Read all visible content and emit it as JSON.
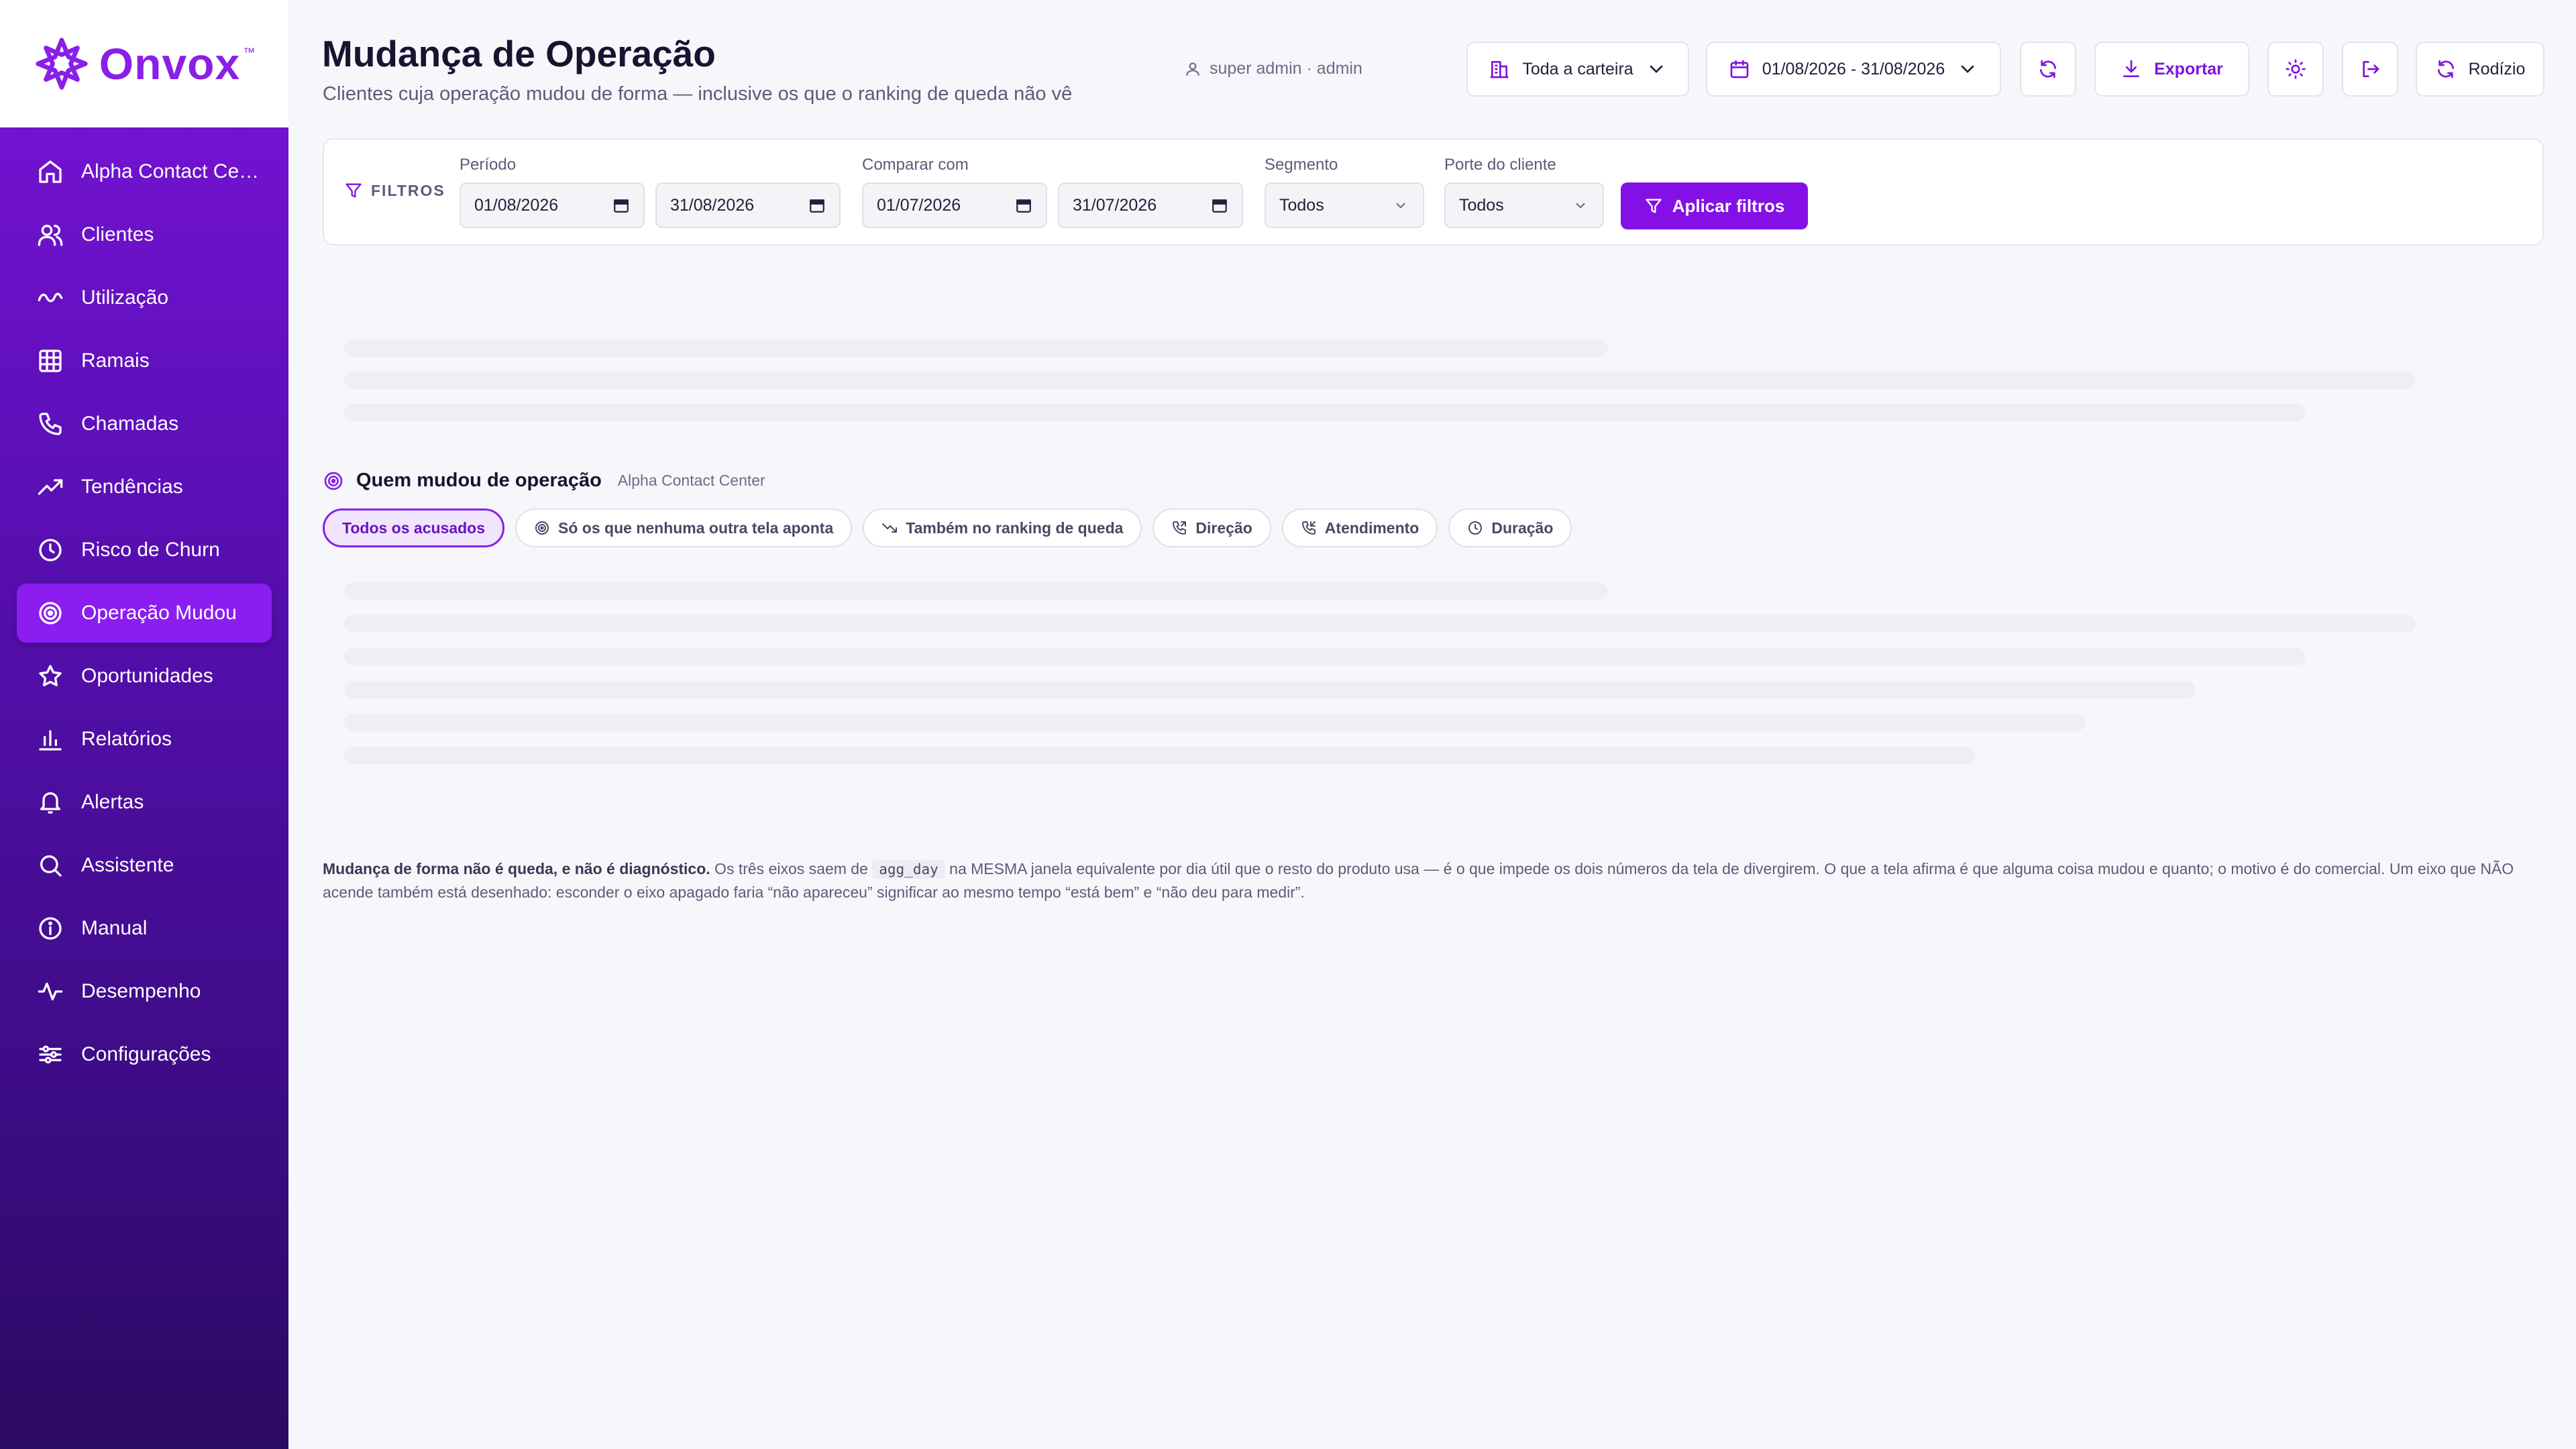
{
  "brand": {
    "name": "Onvox",
    "tm": "™",
    "accent": "#8a1fe8"
  },
  "sidebar": {
    "items": [
      {
        "label": "Alpha Contact Center",
        "icon": "home-icon"
      },
      {
        "label": "Clientes",
        "icon": "users-icon"
      },
      {
        "label": "Utilização",
        "icon": "wave-icon"
      },
      {
        "label": "Ramais",
        "icon": "grid-icon"
      },
      {
        "label": "Chamadas",
        "icon": "phone-icon"
      },
      {
        "label": "Tendências",
        "icon": "trending-up-icon"
      },
      {
        "label": "Risco de Churn",
        "icon": "clock-icon"
      },
      {
        "label": "Operação Mudou",
        "icon": "target-icon",
        "active": true
      },
      {
        "label": "Oportunidades",
        "icon": "star-icon"
      },
      {
        "label": "Relatórios",
        "icon": "bar-chart-icon"
      },
      {
        "label": "Alertas",
        "icon": "bell-icon"
      },
      {
        "label": "Assistente",
        "icon": "search-icon"
      },
      {
        "label": "Manual",
        "icon": "info-icon"
      },
      {
        "label": "Desempenho",
        "icon": "activity-icon"
      },
      {
        "label": "Configurações",
        "icon": "sliders-icon"
      }
    ]
  },
  "header": {
    "title": "Mudança de Operação",
    "subtitle": "Clientes cuja operação mudou de forma — inclusive os que o ranking de queda não vê",
    "user": "super admin · admin",
    "portfolio_label": "Toda a carteira",
    "date_range": "01/08/2026 - 31/08/2026",
    "export_label": "Exportar",
    "rotation_label": "Rodízio"
  },
  "filters": {
    "label": "FILTROS",
    "period_label": "Período",
    "period_start": "01/08/2026",
    "period_end": "31/08/2026",
    "compare_label": "Comparar com",
    "compare_start": "01/07/2026",
    "compare_end": "31/07/2026",
    "segment_label": "Segmento",
    "segment_value": "Todos",
    "size_label": "Porte do cliente",
    "size_value": "Todos",
    "apply_label": "Aplicar filtros"
  },
  "section": {
    "title": "Quem mudou de operação",
    "subtitle": "Alpha Contact Center",
    "chips": [
      {
        "label": "Todos os acusados",
        "active": true
      },
      {
        "label": "Só os que nenhuma outra tela aponta",
        "icon": "target-icon"
      },
      {
        "label": "Também no ranking de queda",
        "icon": "trending-down-icon"
      },
      {
        "label": "Direção",
        "icon": "phone-out-icon"
      },
      {
        "label": "Atendimento",
        "icon": "phone-in-icon"
      },
      {
        "label": "Duração",
        "icon": "clock-icon"
      }
    ]
  },
  "note": {
    "lead": "Mudança de forma não é queda, e não é diagnóstico.",
    "part1": " Os três eixos saem de ",
    "code": "agg_day",
    "part2": " na MESMA janela equivalente por dia útil que o resto do produto usa — é o que impede os dois números da tela de divergirem. O que a tela afirma é que alguma coisa mudou e quanto; o motivo é do comercial. Um eixo que NÃO acende também está desenhado: esconder o eixo apagado faria “não apareceu” significar ao mesmo tempo “está bem” e “não deu para medir”."
  }
}
